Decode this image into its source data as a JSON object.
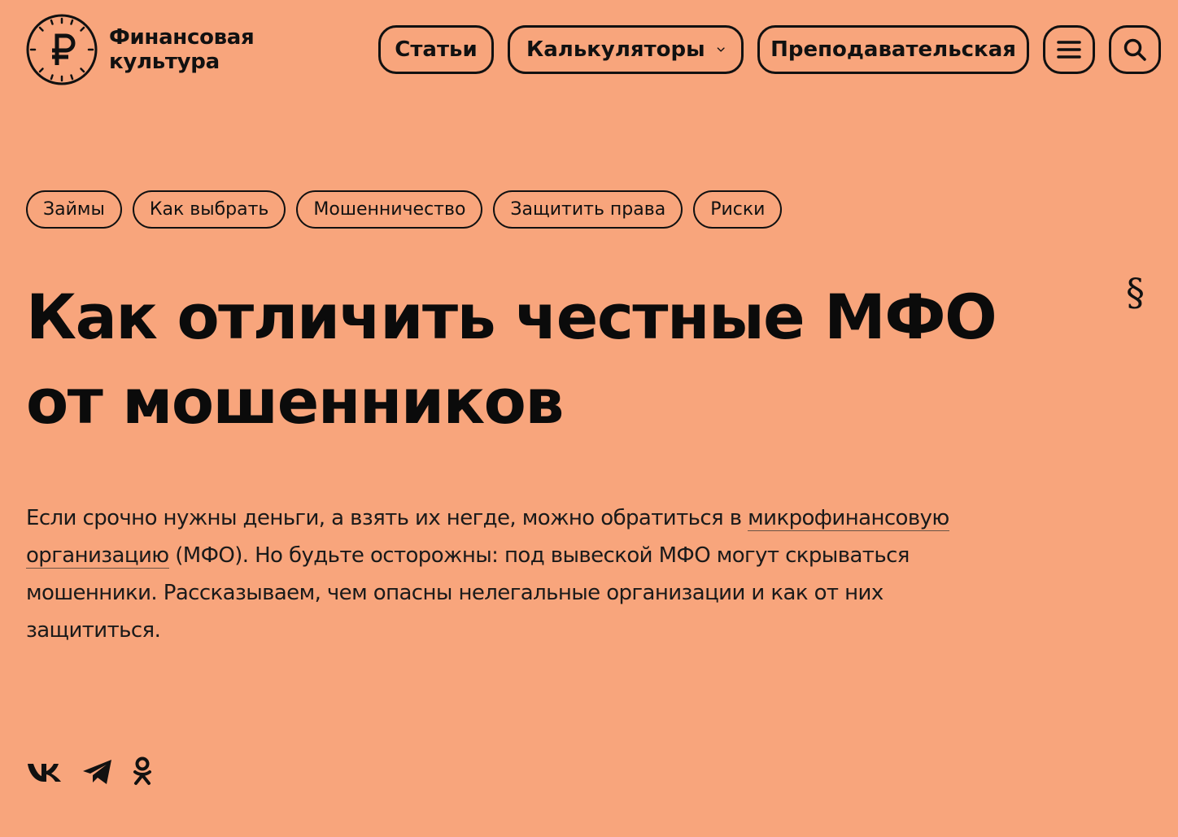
{
  "header": {
    "logo": {
      "line1": "Финансовая",
      "line2": "культура",
      "icon": "ruble-clock-icon"
    },
    "nav": {
      "articles": "Статьи",
      "calculators": "Калькуляторы",
      "teachers": "Преподавательская",
      "menu_icon": "hamburger-menu-icon",
      "search_icon": "search-icon",
      "dropdown_icon": "chevron-down-icon"
    }
  },
  "tags": [
    "Займы",
    "Как выбрать",
    "Мошенничество",
    "Защитить права",
    "Риски"
  ],
  "article": {
    "title": "Как отличить честные МФО от мошенников",
    "section_symbol": "§",
    "lead": {
      "before": "Если срочно нужны деньги, а взять их негде, можно обратиться в ",
      "link": "микрофинансовую организацию",
      "after": " (МФО). Но будьте осторожны: под вывеской МФО могут скрываться мошенники. Рассказываем, чем опасны нелегальные организации и как от них защититься."
    }
  },
  "social": [
    "vk-icon",
    "telegram-icon",
    "odnoklassniki-icon"
  ],
  "colors": {
    "background": "#f8a57c",
    "text": "#111111"
  }
}
